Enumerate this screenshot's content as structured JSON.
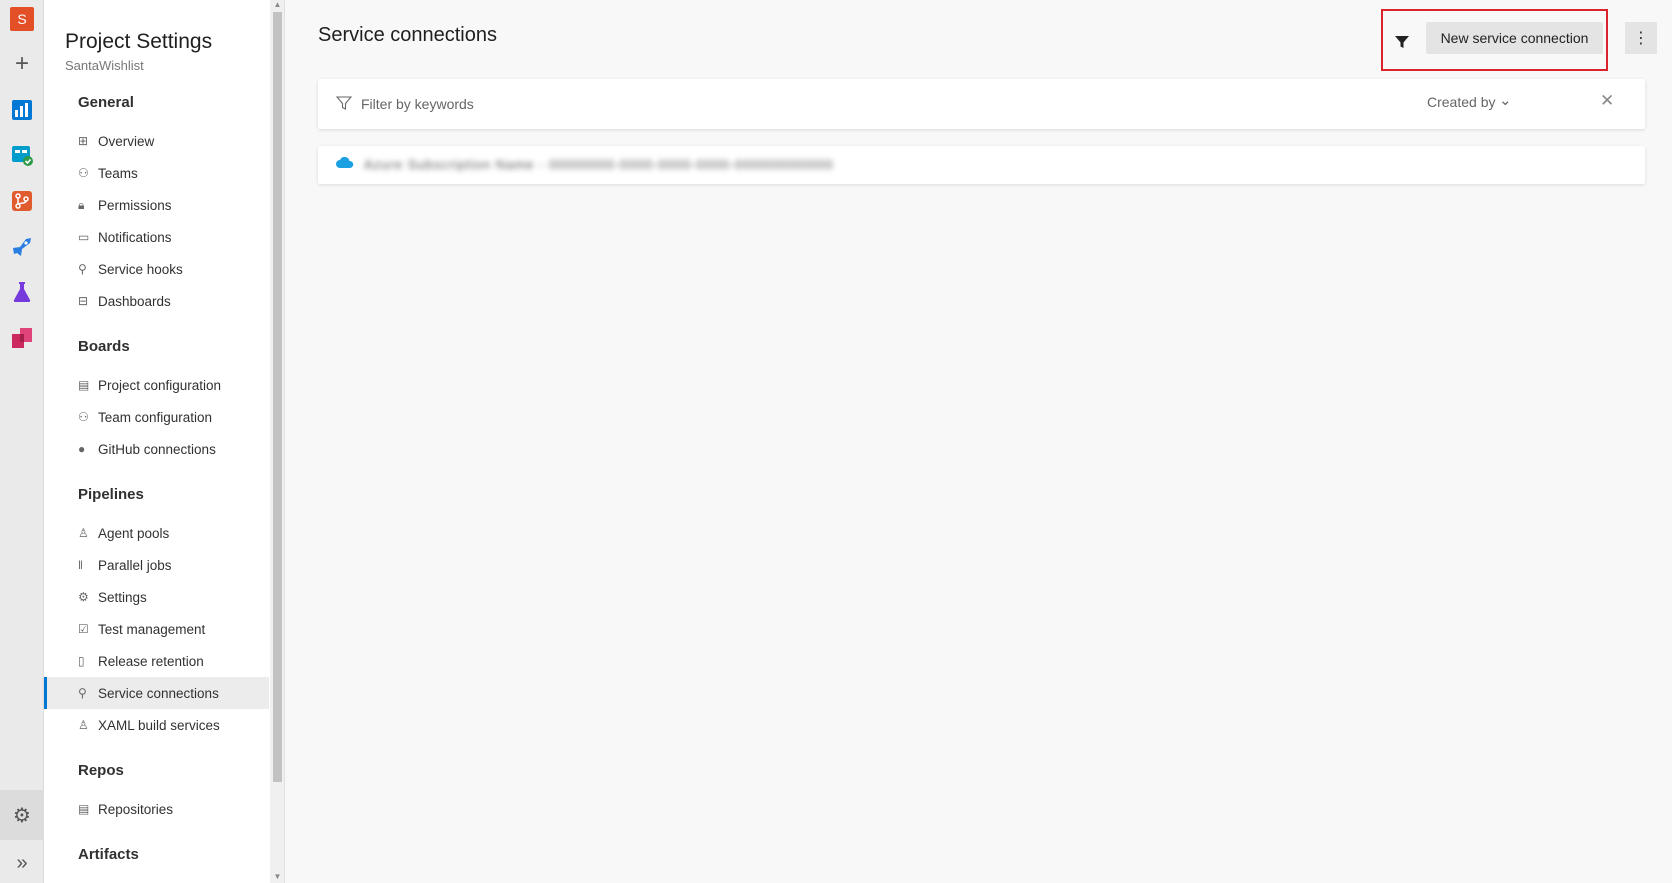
{
  "rail": {
    "org_initial": "S",
    "apps": [
      {
        "name": "boards",
        "color": "#0078d4"
      },
      {
        "name": "test-plans-board",
        "color": "#009ccc"
      },
      {
        "name": "repos",
        "color": "#e05b2e"
      },
      {
        "name": "pipelines",
        "color": "#2a7de1"
      },
      {
        "name": "test-plans",
        "color": "#773adc"
      },
      {
        "name": "artifacts",
        "color": "#cc2a5e"
      }
    ]
  },
  "nav": {
    "title": "Project Settings",
    "project": "SantaWishlist",
    "sections": [
      {
        "label": "General",
        "items": [
          {
            "label": "Overview",
            "icon": "grid-icon"
          },
          {
            "label": "Teams",
            "icon": "teams-icon"
          },
          {
            "label": "Permissions",
            "icon": "lock-icon"
          },
          {
            "label": "Notifications",
            "icon": "chat-icon"
          },
          {
            "label": "Service hooks",
            "icon": "plug-icon"
          },
          {
            "label": "Dashboards",
            "icon": "dashboard-icon"
          }
        ]
      },
      {
        "label": "Boards",
        "items": [
          {
            "label": "Project configuration",
            "icon": "doc-gear-icon"
          },
          {
            "label": "Team configuration",
            "icon": "team-gear-icon"
          },
          {
            "label": "GitHub connections",
            "icon": "github-icon"
          }
        ]
      },
      {
        "label": "Pipelines",
        "items": [
          {
            "label": "Agent pools",
            "icon": "agent-icon"
          },
          {
            "label": "Parallel jobs",
            "icon": "parallel-icon"
          },
          {
            "label": "Settings",
            "icon": "gear-icon"
          },
          {
            "label": "Test management",
            "icon": "test-icon"
          },
          {
            "label": "Release retention",
            "icon": "phone-icon"
          },
          {
            "label": "Service connections",
            "icon": "plug-icon",
            "selected": true
          },
          {
            "label": "XAML build services",
            "icon": "agent-icon"
          }
        ]
      },
      {
        "label": "Repos",
        "items": [
          {
            "label": "Repositories",
            "icon": "repo-icon"
          }
        ]
      },
      {
        "label": "Artifacts",
        "items": []
      }
    ]
  },
  "main": {
    "title": "Service connections",
    "new_button": "New service connection",
    "filter_placeholder": "Filter by keywords",
    "created_by": "Created by",
    "connections": [
      {
        "name": "Azure Subscription Name - 00000000-0000-0000-0000-000000000000",
        "blurred": true
      }
    ]
  },
  "colors": {
    "accent": "#0078d4",
    "highlight": "#d9232d",
    "cloud": "#1ba1e2"
  }
}
